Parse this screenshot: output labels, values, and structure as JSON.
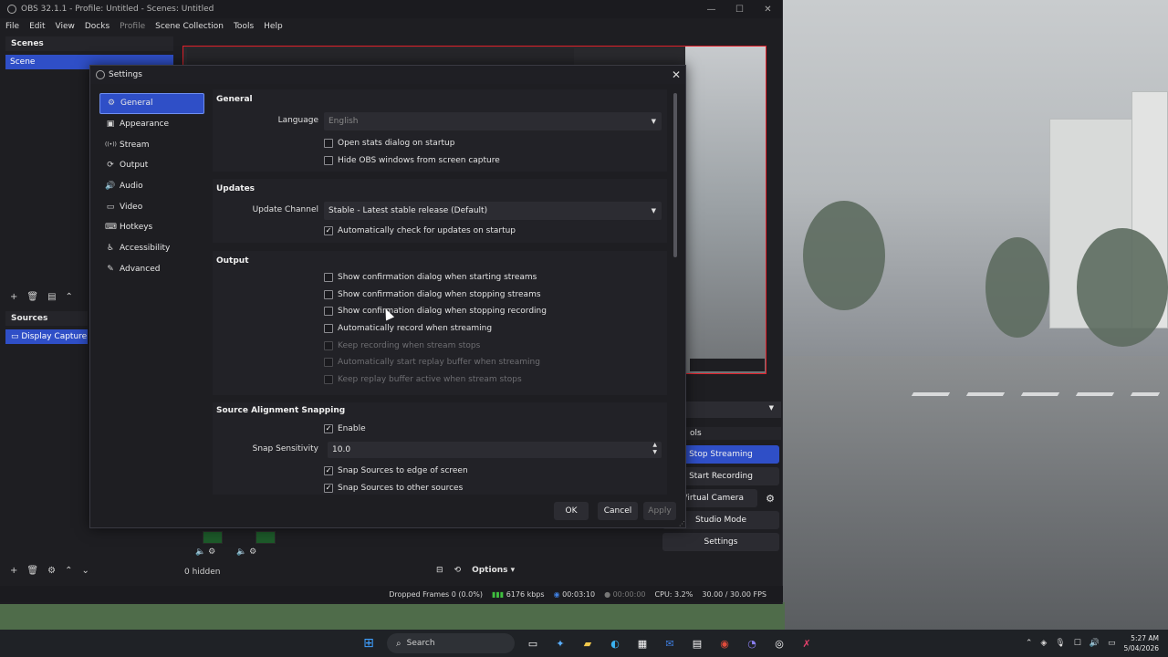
{
  "obs": {
    "window_title": "OBS 32.1.1 - Profile: Untitled - Scenes: Untitled",
    "menu": [
      "File",
      "Edit",
      "View",
      "Docks",
      "Profile",
      "Scene Collection",
      "Tools",
      "Help"
    ],
    "scenes_title": "Scenes",
    "scene_selected": "Scene",
    "sources_title": "Sources",
    "source_selected": "Display Capture",
    "hidden_count": "0 hidden",
    "options_label": "Options",
    "controls_title": "ols",
    "controls": {
      "stop_streaming": "Stop Streaming",
      "start_recording": "Start Recording",
      "virtual_camera": "t Virtual Camera",
      "studio_mode": "Studio Mode",
      "settings": "Settings"
    },
    "status": {
      "dropped_frames": "Dropped Frames 0 (0.0%)",
      "bitrate": "6176 kbps",
      "stream_time": "00:03:10",
      "rec_time": "00:00:00",
      "cpu": "CPU: 3.2%",
      "fps": "30.00 / 30.00 FPS"
    }
  },
  "settings": {
    "title": "Settings",
    "nav": [
      {
        "label": "General",
        "icon": "gear-icon",
        "glyph": "⚙"
      },
      {
        "label": "Appearance",
        "icon": "appearance-icon",
        "glyph": "▣"
      },
      {
        "label": "Stream",
        "icon": "stream-icon",
        "glyph": "((•))"
      },
      {
        "label": "Output",
        "icon": "output-icon",
        "glyph": "⟳"
      },
      {
        "label": "Audio",
        "icon": "speaker-icon",
        "glyph": "🔊"
      },
      {
        "label": "Video",
        "icon": "monitor-icon",
        "glyph": "▭"
      },
      {
        "label": "Hotkeys",
        "icon": "keyboard-icon",
        "glyph": "⌨"
      },
      {
        "label": "Accessibility",
        "icon": "accessibility-icon",
        "glyph": "♿"
      },
      {
        "label": "Advanced",
        "icon": "wrench-icon",
        "glyph": "✎"
      }
    ],
    "selected_nav": "General",
    "general": {
      "title": "General",
      "language_label": "Language",
      "language_value": "English",
      "open_stats": {
        "label": "Open stats dialog on startup",
        "checked": false
      },
      "hide_obs": {
        "label": "Hide OBS windows from screen capture",
        "checked": false
      }
    },
    "updates": {
      "title": "Updates",
      "channel_label": "Update Channel",
      "channel_value": "Stable - Latest stable release (Default)",
      "auto_check": {
        "label": "Automatically check for updates on startup",
        "checked": true
      }
    },
    "output": {
      "title": "Output",
      "items": [
        {
          "label": "Show confirmation dialog when starting streams",
          "checked": false,
          "enabled": true
        },
        {
          "label": "Show confirmation dialog when stopping streams",
          "checked": false,
          "enabled": true
        },
        {
          "label": "Show confirmation dialog when stopping recording",
          "checked": false,
          "enabled": true
        },
        {
          "label": "Automatically record when streaming",
          "checked": false,
          "enabled": true
        },
        {
          "label": "Keep recording when stream stops",
          "checked": false,
          "enabled": false
        },
        {
          "label": "Automatically start replay buffer when streaming",
          "checked": false,
          "enabled": false
        },
        {
          "label": "Keep replay buffer active when stream stops",
          "checked": false,
          "enabled": false
        }
      ]
    },
    "snapping": {
      "title": "Source Alignment Snapping",
      "enable": {
        "label": "Enable",
        "checked": true
      },
      "sensitivity_label": "Snap Sensitivity",
      "sensitivity_value": "10.0",
      "edge": {
        "label": "Snap Sources to edge of screen",
        "checked": true
      },
      "other": {
        "label": "Snap Sources to other sources",
        "checked": true
      }
    },
    "buttons": {
      "ok": "OK",
      "cancel": "Cancel",
      "apply": "Apply"
    }
  },
  "taskbar": {
    "search_label": "Search",
    "time": "5:27 AM",
    "date": "5/04/2026"
  },
  "colors": {
    "accent": "#2f4fc7",
    "live_border": "#e0202a"
  }
}
